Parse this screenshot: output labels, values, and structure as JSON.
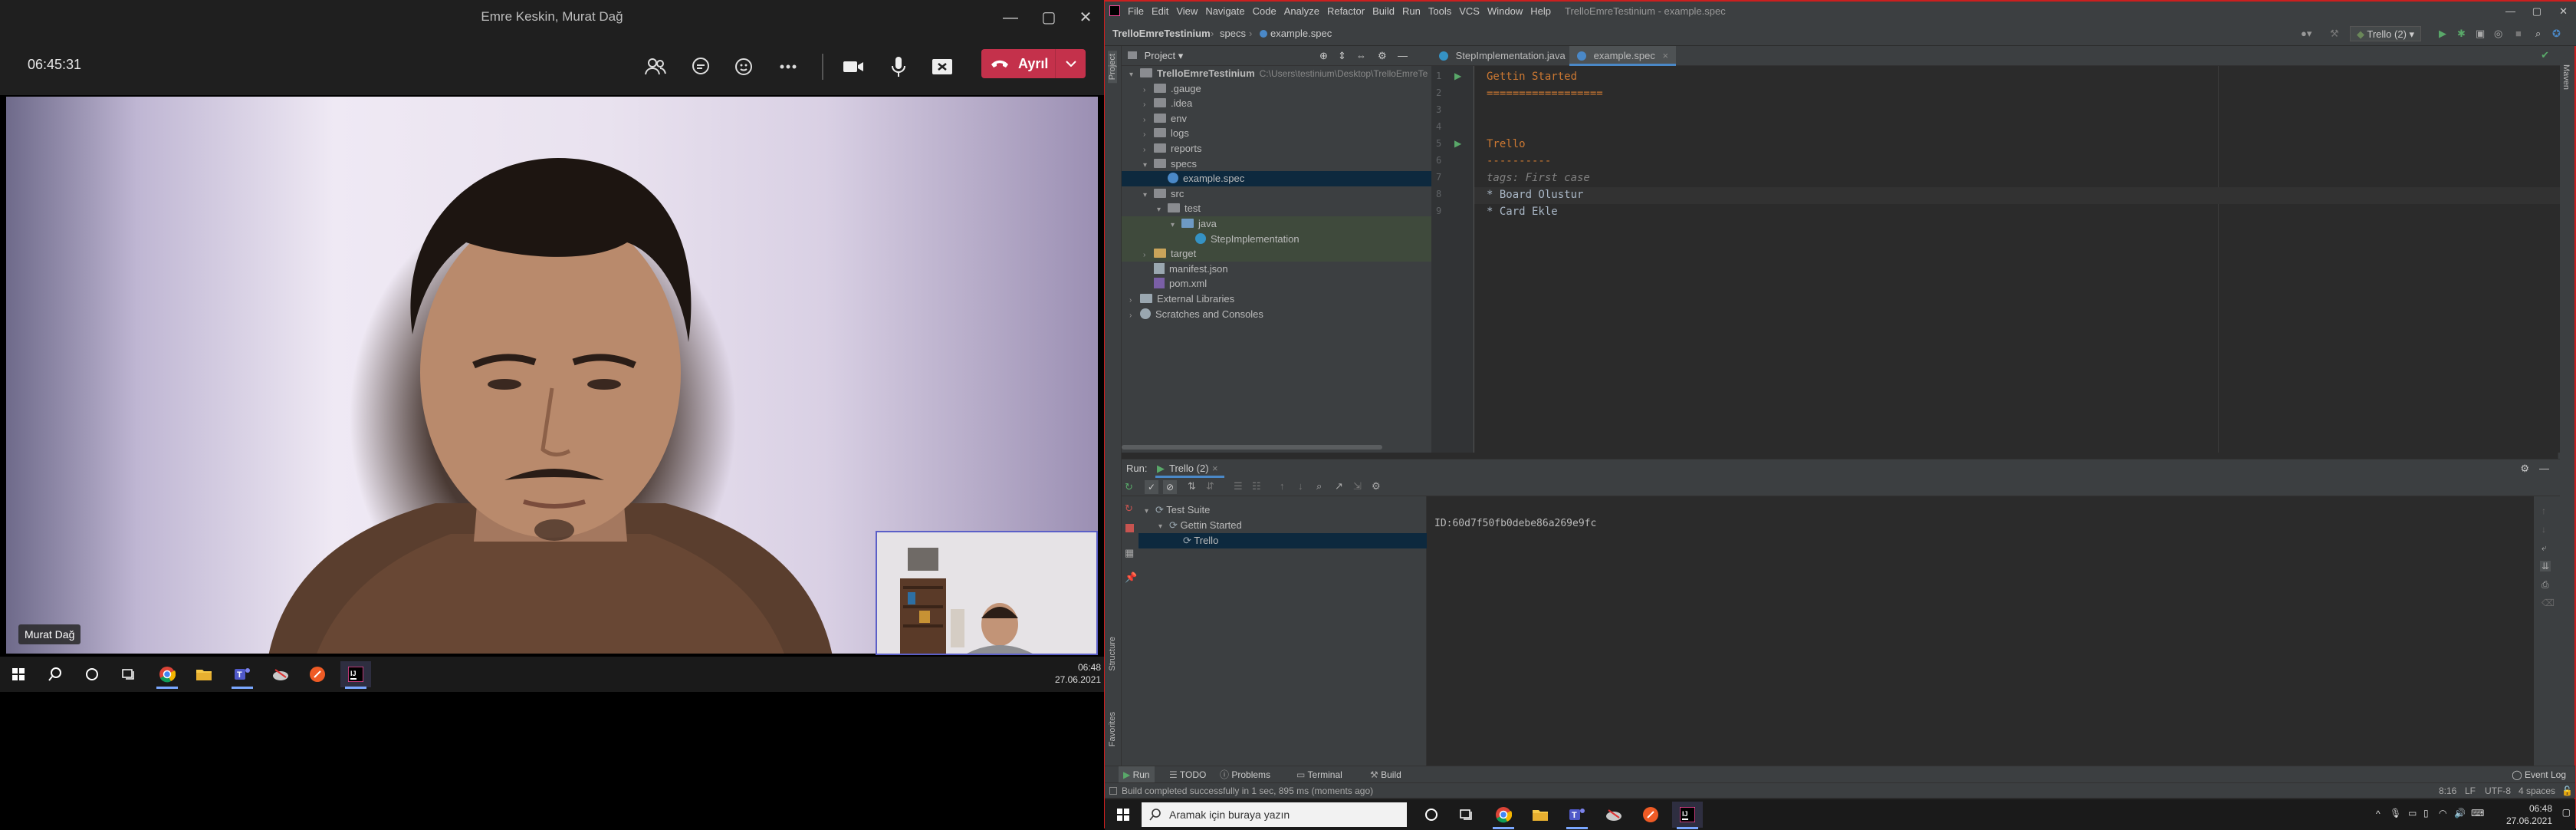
{
  "teams": {
    "window_title": "Emre Keskin, Murat Dağ",
    "call_timer": "06:45:31",
    "leave_label": "Ayrıl",
    "participant_name": "Murat Dağ",
    "controls": [
      "people-icon",
      "chat-icon",
      "reactions-icon",
      "more-icon",
      "camera-icon",
      "mic-icon",
      "share-icon"
    ]
  },
  "taskbar_left": {
    "time": "06:48",
    "date": "27.06.2021"
  },
  "ide": {
    "menu": [
      "File",
      "Edit",
      "View",
      "Navigate",
      "Code",
      "Analyze",
      "Refactor",
      "Build",
      "Run",
      "Tools",
      "VCS",
      "Window",
      "Help"
    ],
    "window_title": "TrelloEmreTestinium - example.spec",
    "breadcrumb": [
      "TrelloEmreTestinium",
      "specs",
      "example.spec"
    ],
    "run_config": "Trello (2)",
    "project_panel_title": "Project",
    "project_tree": [
      {
        "label": "TrelloEmreTestinium",
        "suffix": "C:\\Users\\testinium\\Desktop\\TrelloEmreTe",
        "level": 0,
        "type": "root",
        "open": true
      },
      {
        "label": ".gauge",
        "level": 1,
        "type": "folder"
      },
      {
        "label": ".idea",
        "level": 1,
        "type": "folder"
      },
      {
        "label": "env",
        "level": 1,
        "type": "folder"
      },
      {
        "label": "logs",
        "level": 1,
        "type": "folder"
      },
      {
        "label": "reports",
        "level": 1,
        "type": "folder"
      },
      {
        "label": "specs",
        "level": 1,
        "type": "folder",
        "open": true
      },
      {
        "label": "example.spec",
        "level": 2,
        "type": "spec",
        "selected": true
      },
      {
        "label": "src",
        "level": 1,
        "type": "folder",
        "open": true
      },
      {
        "label": "test",
        "level": 2,
        "type": "folder",
        "open": true
      },
      {
        "label": "java",
        "level": 3,
        "type": "folder",
        "open": true,
        "highlight": true
      },
      {
        "label": "StepImplementation",
        "level": 4,
        "type": "class",
        "highlight": true
      },
      {
        "label": "target",
        "level": 1,
        "type": "folder",
        "highlight": true
      },
      {
        "label": "manifest.json",
        "level": 1,
        "type": "file"
      },
      {
        "label": "pom.xml",
        "level": 1,
        "type": "maven"
      },
      {
        "label": "External Libraries",
        "level": 0,
        "type": "lib"
      },
      {
        "label": "Scratches and Consoles",
        "level": 0,
        "type": "scratch"
      }
    ],
    "tabs": [
      {
        "label": "StepImplementation.java",
        "active": false
      },
      {
        "label": "example.spec",
        "active": true
      }
    ],
    "code_lines": [
      {
        "n": "1",
        "text": "Gettin Started",
        "color": "#cc7832",
        "run": true
      },
      {
        "n": "2",
        "text": "==================",
        "color": "#cc7832"
      },
      {
        "n": "3",
        "text": "",
        "color": "#a9b7c6"
      },
      {
        "n": "4",
        "text": "",
        "color": "#a9b7c6"
      },
      {
        "n": "5",
        "text": "Trello",
        "color": "#cc7832",
        "run": true
      },
      {
        "n": "6",
        "text": "----------",
        "color": "#cc7832"
      },
      {
        "n": "7",
        "text": "tags: First case",
        "color": "#808080",
        "italic": true
      },
      {
        "n": "8",
        "text": "* Board Olustur",
        "color": "#a9b7c6",
        "current": true
      },
      {
        "n": "9",
        "text": "* Card Ekle",
        "color": "#a9b7c6"
      }
    ],
    "run_label": "Run:",
    "run_tab": "Trello (2)",
    "run_tree": [
      {
        "label": "Test Suite",
        "level": 0
      },
      {
        "label": "Gettin Started",
        "level": 1
      },
      {
        "label": "Trello",
        "level": 2,
        "selected": true
      }
    ],
    "run_output": "ID:60d7f50fb0debe86a269e9fc",
    "bottom_tabs": [
      "Run",
      "TODO",
      "Problems",
      "Terminal",
      "Build"
    ],
    "event_log": "Event Log",
    "status_message": "Build completed successfully in 1 sec, 895 ms (moments ago)",
    "status_right": [
      "8:16",
      "LF",
      "UTF-8",
      "4 spaces"
    ],
    "side_labels": {
      "project": "Project",
      "structure": "Structure",
      "favorites": "Favorites",
      "maven": "Maven"
    }
  },
  "taskbar_right": {
    "search_placeholder": "Aramak için buraya yazın",
    "time": "06:48",
    "date": "27.06.2021"
  }
}
